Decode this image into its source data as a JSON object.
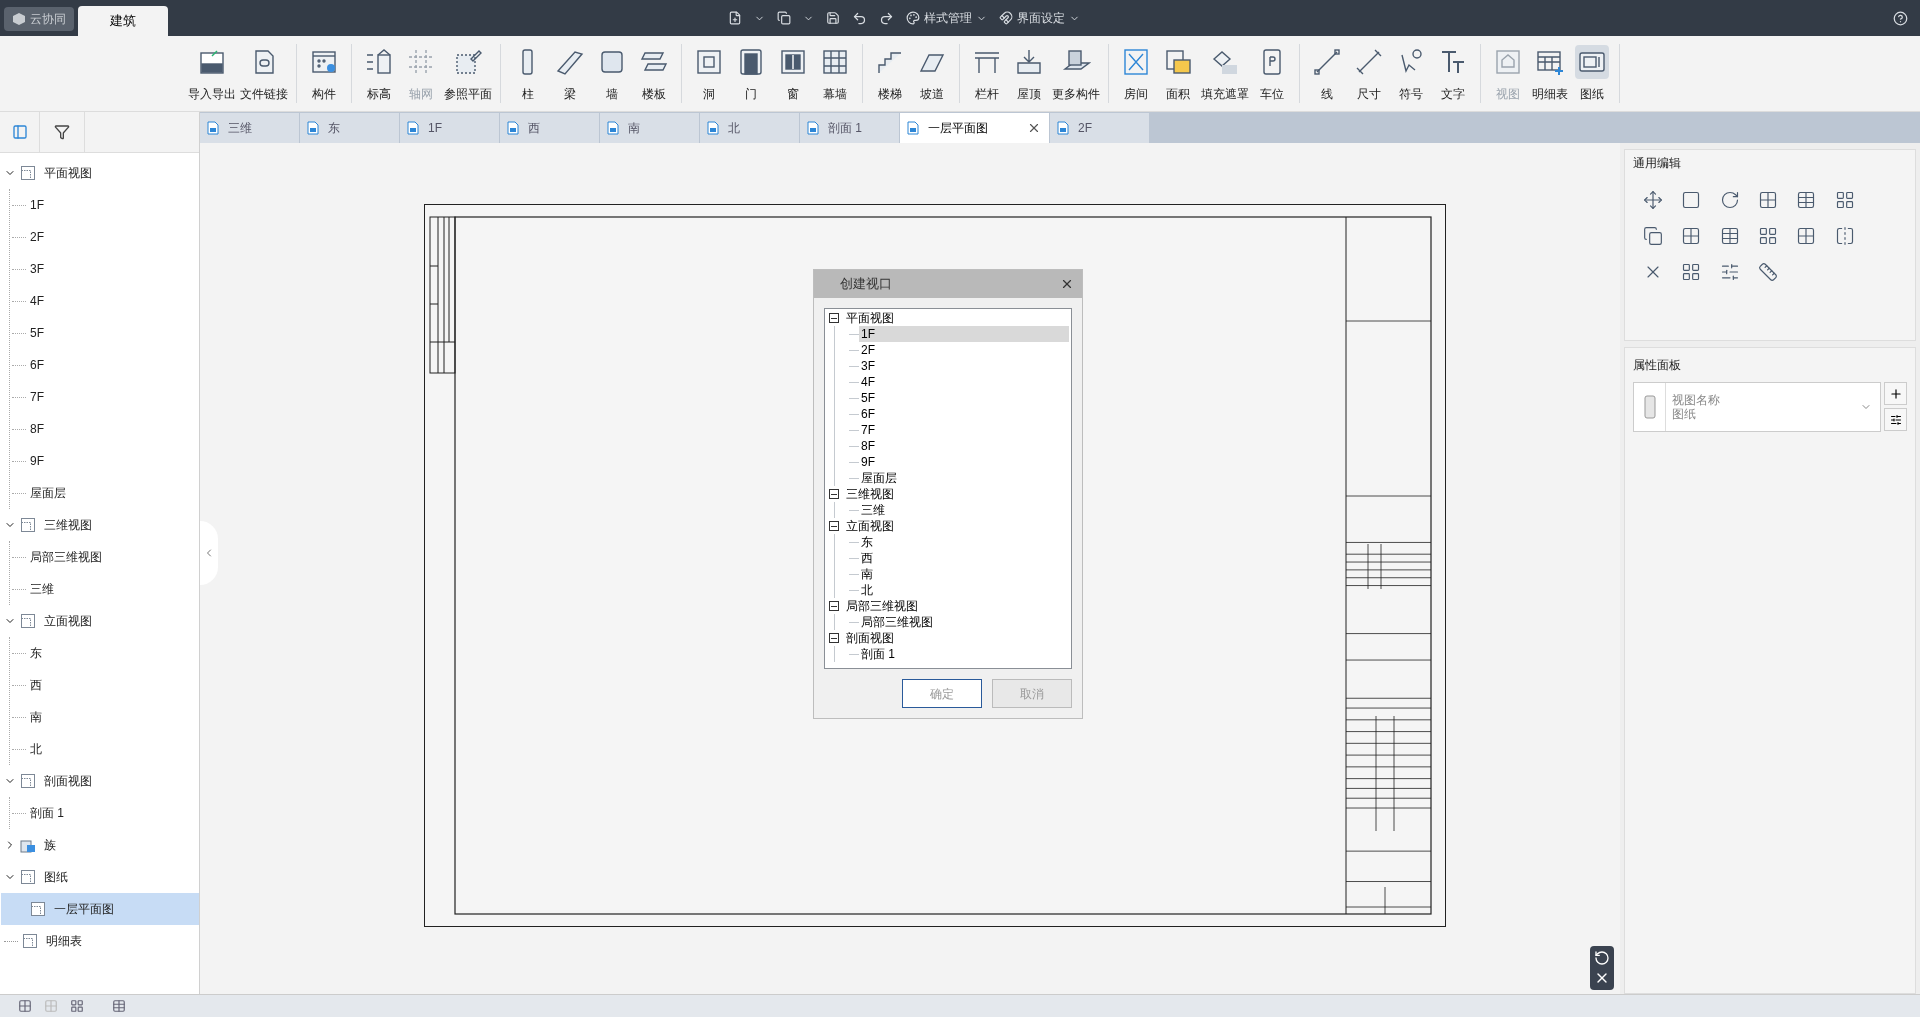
{
  "top_bar": {
    "cloud_button": "云协同",
    "tabs": [
      {
        "label": "建筑",
        "selected": true
      }
    ],
    "menus": [
      {
        "label": "样式管理"
      },
      {
        "label": "界面设定"
      }
    ]
  },
  "ribbon": {
    "groups": [
      {
        "items": [
          {
            "label": "导入导出",
            "kind": "cad",
            "disabled": false,
            "selected": false
          },
          {
            "label": "文件链接",
            "kind": "link",
            "disabled": false,
            "selected": false
          }
        ]
      },
      {
        "items": [
          {
            "label": "构件",
            "kind": "component",
            "disabled": false,
            "selected": false
          }
        ]
      },
      {
        "items": [
          {
            "label": "标高",
            "kind": "level",
            "disabled": false,
            "selected": false
          },
          {
            "label": "轴网",
            "kind": "grid",
            "disabled": true,
            "selected": false
          },
          {
            "label": "参照平面",
            "kind": "plane",
            "disabled": false,
            "selected": false
          }
        ]
      },
      {
        "items": [
          {
            "label": "柱",
            "kind": "column",
            "disabled": false,
            "selected": false
          },
          {
            "label": "梁",
            "kind": "beam",
            "disabled": false,
            "selected": false
          },
          {
            "label": "墙",
            "kind": "wall",
            "disabled": false,
            "selected": false
          },
          {
            "label": "楼板",
            "kind": "slab",
            "disabled": false,
            "selected": false
          }
        ]
      },
      {
        "items": [
          {
            "label": "洞",
            "kind": "hole",
            "disabled": false,
            "selected": false
          },
          {
            "label": "门",
            "kind": "door",
            "disabled": false,
            "selected": false
          },
          {
            "label": "窗",
            "kind": "window",
            "disabled": false,
            "selected": false
          },
          {
            "label": "幕墙",
            "kind": "curtain",
            "disabled": false,
            "selected": false
          }
        ]
      },
      {
        "items": [
          {
            "label": "楼梯",
            "kind": "stair",
            "disabled": false,
            "selected": false
          },
          {
            "label": "坡道",
            "kind": "ramp",
            "disabled": false,
            "selected": false
          }
        ]
      },
      {
        "items": [
          {
            "label": "栏杆",
            "kind": "railing",
            "disabled": false,
            "selected": false
          },
          {
            "label": "屋顶",
            "kind": "roof",
            "disabled": false,
            "selected": false
          },
          {
            "label": "更多构件",
            "kind": "more",
            "disabled": false,
            "selected": false
          }
        ]
      },
      {
        "items": [
          {
            "label": "房间",
            "kind": "room",
            "disabled": false,
            "selected": false
          },
          {
            "label": "面积",
            "kind": "area",
            "disabled": false,
            "selected": false
          },
          {
            "label": "填充遮罩",
            "kind": "fill",
            "disabled": false,
            "selected": false
          },
          {
            "label": "车位",
            "kind": "parking",
            "disabled": false,
            "selected": false
          }
        ]
      },
      {
        "items": [
          {
            "label": "线",
            "kind": "line",
            "disabled": false,
            "selected": false
          },
          {
            "label": "尺寸",
            "kind": "dimension",
            "disabled": false,
            "selected": false
          },
          {
            "label": "符号",
            "kind": "symbol",
            "disabled": false,
            "selected": false
          },
          {
            "label": "文字",
            "kind": "text",
            "disabled": false,
            "selected": false
          }
        ]
      },
      {
        "items": [
          {
            "label": "视图",
            "kind": "view",
            "disabled": true,
            "selected": false
          },
          {
            "label": "明细表",
            "kind": "schedule",
            "disabled": false,
            "selected": false
          },
          {
            "label": "图纸",
            "kind": "sheet",
            "disabled": false,
            "selected": true
          }
        ]
      }
    ]
  },
  "document_tabs": [
    {
      "label": "三维",
      "selected": false
    },
    {
      "label": "东",
      "selected": false
    },
    {
      "label": "1F",
      "selected": false
    },
    {
      "label": "西",
      "selected": false
    },
    {
      "label": "南",
      "selected": false
    },
    {
      "label": "北",
      "selected": false
    },
    {
      "label": "剖面 1",
      "selected": false
    },
    {
      "label": "一层平面图",
      "selected": true
    },
    {
      "label": "2F",
      "selected": false
    }
  ],
  "project_tree": [
    {
      "label": "平面视图",
      "kind": "folder",
      "expanded": true,
      "selected": false,
      "children": [
        {
          "label": "1F",
          "selected": false
        },
        {
          "label": "2F",
          "selected": false
        },
        {
          "label": "3F",
          "selected": false
        },
        {
          "label": "4F",
          "selected": false
        },
        {
          "label": "5F",
          "selected": false
        },
        {
          "label": "6F",
          "selected": false
        },
        {
          "label": "7F",
          "selected": false
        },
        {
          "label": "8F",
          "selected": false
        },
        {
          "label": "9F",
          "selected": false
        },
        {
          "label": "屋面层",
          "selected": false
        }
      ]
    },
    {
      "label": "三维视图",
      "kind": "folder",
      "expanded": true,
      "selected": false,
      "children": [
        {
          "label": "局部三维视图",
          "selected": false
        },
        {
          "label": "三维",
          "selected": false
        }
      ]
    },
    {
      "label": "立面视图",
      "kind": "folder",
      "expanded": true,
      "selected": false,
      "children": [
        {
          "label": "东",
          "selected": false
        },
        {
          "label": "西",
          "selected": false
        },
        {
          "label": "南",
          "selected": false
        },
        {
          "label": "北",
          "selected": false
        }
      ]
    },
    {
      "label": "剖面视图",
      "kind": "folder",
      "expanded": true,
      "selected": false,
      "children": [
        {
          "label": "剖面 1",
          "selected": false
        }
      ]
    },
    {
      "label": "族",
      "kind": "family",
      "expanded": false,
      "selected": false
    },
    {
      "label": "图纸",
      "kind": "folder",
      "expanded": true,
      "selected": false,
      "children": [
        {
          "label": "一层平面图",
          "kind": "sheet",
          "selected": true
        }
      ]
    },
    {
      "label": "明细表",
      "kind": "leaf",
      "selected": false
    }
  ],
  "dialog": {
    "title": "创建视口",
    "tree": [
      {
        "label": "平面视图",
        "expanded": true,
        "children": [
          {
            "label": "1F",
            "selected": true
          },
          {
            "label": "2F",
            "selected": false
          },
          {
            "label": "3F",
            "selected": false
          },
          {
            "label": "4F",
            "selected": false
          },
          {
            "label": "5F",
            "selected": false
          },
          {
            "label": "6F",
            "selected": false
          },
          {
            "label": "7F",
            "selected": false
          },
          {
            "label": "8F",
            "selected": false
          },
          {
            "label": "9F",
            "selected": false
          },
          {
            "label": "屋面层",
            "selected": false
          }
        ]
      },
      {
        "label": "三维视图",
        "expanded": true,
        "children": [
          {
            "label": "三维",
            "selected": false
          }
        ]
      },
      {
        "label": "立面视图",
        "expanded": true,
        "children": [
          {
            "label": "东",
            "selected": false
          },
          {
            "label": "西",
            "selected": false
          },
          {
            "label": "南",
            "selected": false
          },
          {
            "label": "北",
            "selected": false
          }
        ]
      },
      {
        "label": "局部三维视图",
        "expanded": true,
        "children": [
          {
            "label": "局部三维视图",
            "selected": false
          }
        ]
      },
      {
        "label": "剖面视图",
        "expanded": true,
        "children": [
          {
            "label": "剖面 1",
            "selected": false
          }
        ]
      }
    ],
    "buttons": [
      {
        "label": "确定",
        "kind": "primary"
      },
      {
        "label": "取消",
        "kind": "secondary"
      }
    ]
  },
  "edit_panel": {
    "title": "通用编辑"
  },
  "property_panel": {
    "title": "属性面板",
    "type_label": "视图名称",
    "type_value": "图纸"
  }
}
